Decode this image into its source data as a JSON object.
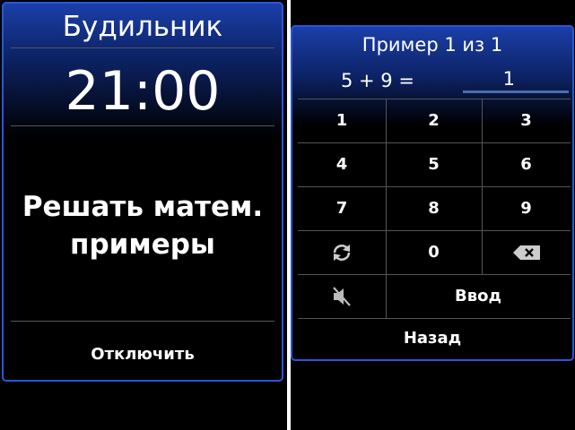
{
  "alarm": {
    "title": "Будильник",
    "time": "21:00",
    "task_line1": "Решать матем.",
    "task_line2": "примеры",
    "dismiss_label": "Отключить"
  },
  "math": {
    "title": "Пример 1 из 1",
    "equation": "5 + 9 =",
    "answer": "1",
    "keys": {
      "k1": "1",
      "k2": "2",
      "k3": "3",
      "k4": "4",
      "k5": "5",
      "k6": "6",
      "k7": "7",
      "k8": "8",
      "k9": "9",
      "k0": "0",
      "enter": "Ввод"
    },
    "back_label": "Назад"
  },
  "colors": {
    "accent": "#2a56d8",
    "header_gradient": "#1b3fa9"
  }
}
